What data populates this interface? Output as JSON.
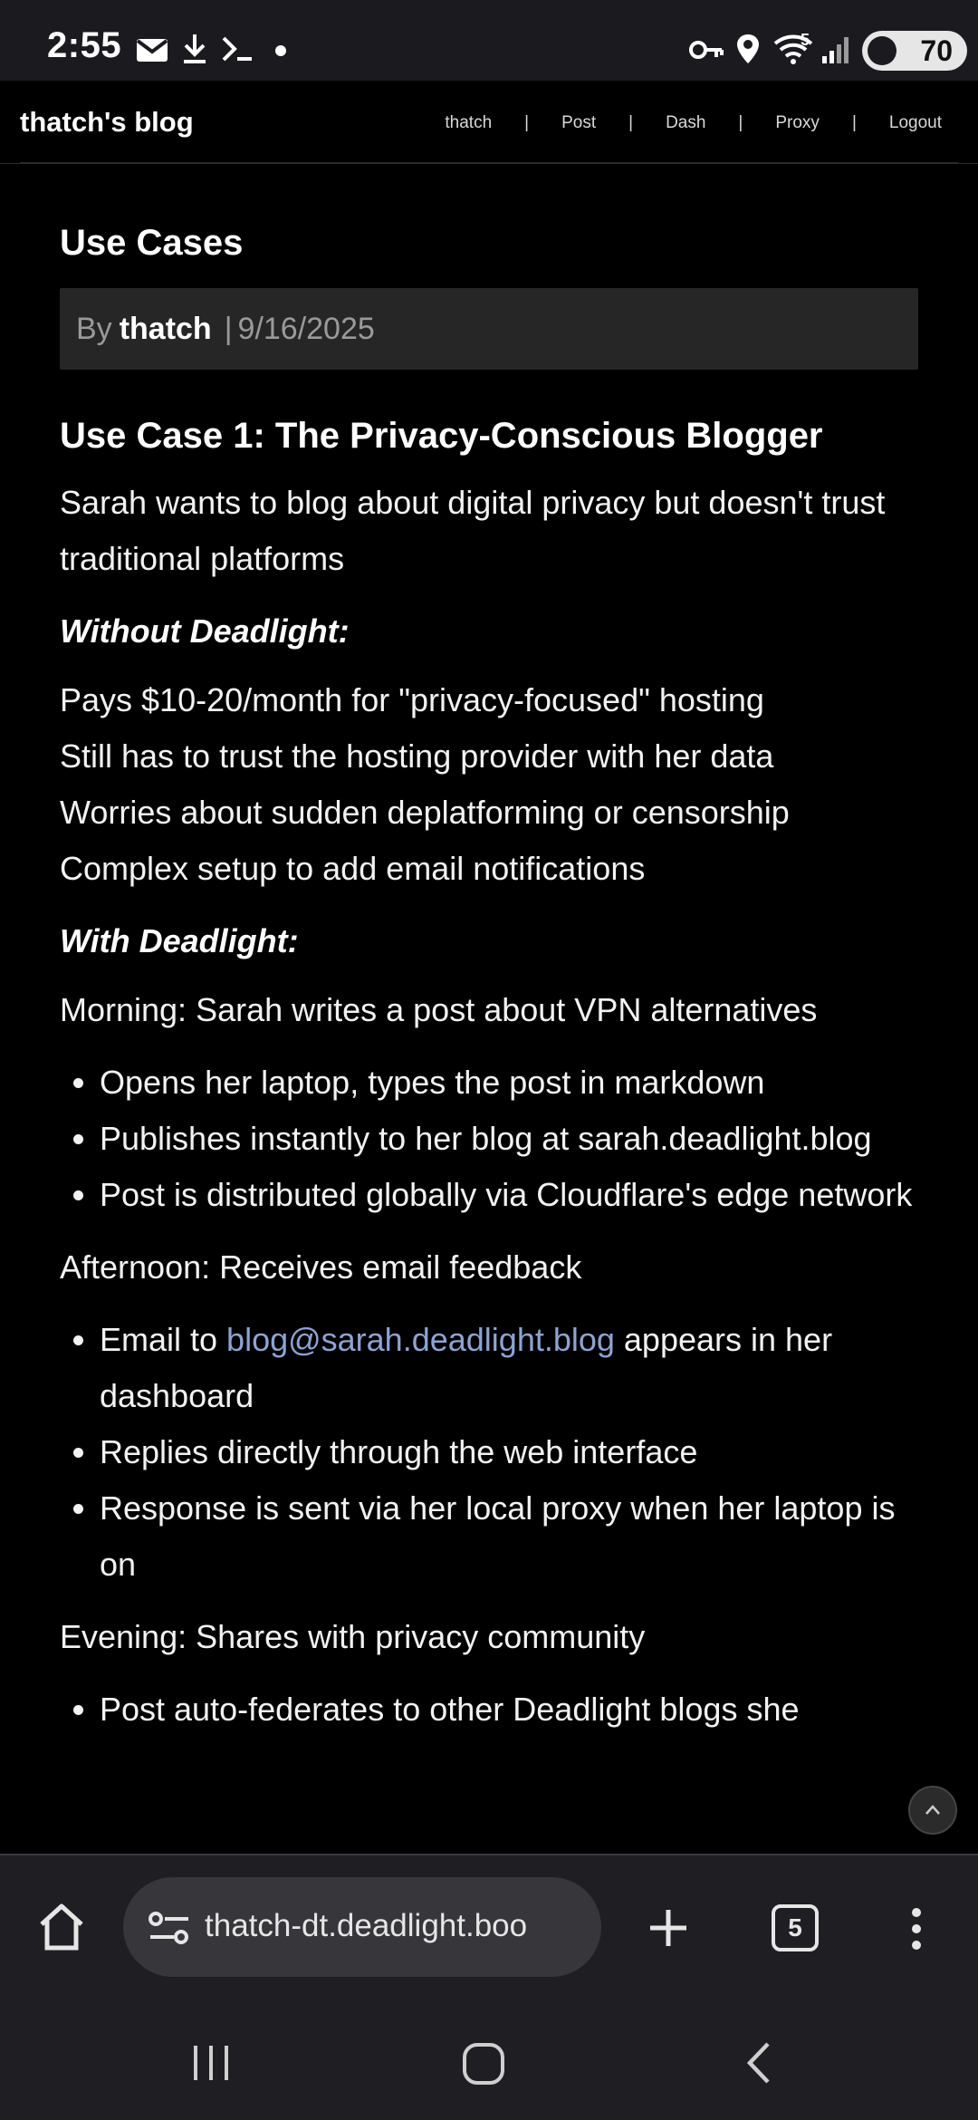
{
  "status_bar": {
    "time": "2:55",
    "battery": "70",
    "wifi_level": "5",
    "icons": [
      "gmail-icon",
      "download-icon",
      "terminal-icon",
      "dot-icon",
      "key-icon",
      "location-icon",
      "wifi-icon",
      "signal-icon"
    ]
  },
  "site": {
    "title": "thatch's blog",
    "nav": [
      "thatch",
      "Post",
      "Dash",
      "Proxy",
      "Logout"
    ],
    "nav_separator": "|"
  },
  "post": {
    "title": "Use Cases",
    "meta": {
      "by": "By",
      "author": "thatch",
      "separator": "|",
      "date": "9/16/2025"
    },
    "section_heading": "Use Case 1: The Privacy-Conscious Blogger",
    "intro": "Sarah wants to blog about digital privacy but doesn't trust traditional platforms",
    "without_heading": "Without Deadlight:",
    "without_lines": [
      "Pays $10-20/month for \"privacy-focused\" hosting",
      "Still has to trust the hosting provider with her data",
      "Worries about sudden deplatforming or censorship",
      "Complex setup to add email notifications"
    ],
    "with_heading": "With Deadlight:",
    "morning": "Morning: Sarah writes a post about VPN alternatives",
    "morning_items": [
      "Opens her laptop, types the post in markdown",
      "Publishes instantly to her blog at sarah.deadlight.blog",
      "Post is distributed globally via Cloudflare's edge network"
    ],
    "afternoon": "Afternoon: Receives email feedback",
    "afternoon_email_prefix": "Email to ",
    "afternoon_email_link": "blog@sarah.deadlight.blog",
    "afternoon_email_suffix": " appears in her dashboard",
    "afternoon_items": [
      "Replies directly through the web interface",
      "Response is sent via her local proxy when her laptop is on"
    ],
    "evening": "Evening: Shares with privacy community",
    "evening_items": [
      "Post auto-federates to other Deadlight blogs she"
    ]
  },
  "browser": {
    "url": "thatch-dt.deadlight.boo",
    "tab_count": "5"
  },
  "colors": {
    "background": "#000000",
    "header_bar": "#1b1b1f",
    "meta_box": "#262626",
    "link": "#8fa3d1",
    "browser_bar": "#1f1f23",
    "url_pill": "#36363b"
  }
}
